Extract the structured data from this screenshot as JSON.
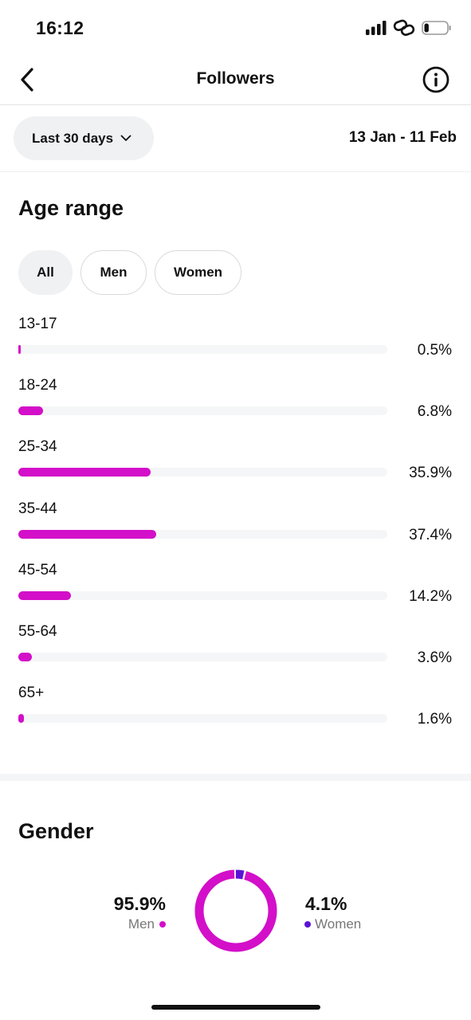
{
  "status_bar": {
    "time": "16:12",
    "battery_level": 0.2
  },
  "header": {
    "title": "Followers"
  },
  "filters": {
    "range_label": "Last 30 days",
    "date_range": "13 Jan - 11 Feb"
  },
  "age_section": {
    "title": "Age range",
    "tabs": [
      {
        "label": "All",
        "selected": true
      },
      {
        "label": "Men",
        "selected": false
      },
      {
        "label": "Women",
        "selected": false
      }
    ],
    "rows": [
      {
        "label": "13-17",
        "percent_text": "0.5%",
        "value": 0.5
      },
      {
        "label": "18-24",
        "percent_text": "6.8%",
        "value": 6.8
      },
      {
        "label": "25-34",
        "percent_text": "35.9%",
        "value": 35.9
      },
      {
        "label": "35-44",
        "percent_text": "37.4%",
        "value": 37.4
      },
      {
        "label": "45-54",
        "percent_text": "14.2%",
        "value": 14.2
      },
      {
        "label": "55-64",
        "percent_text": "3.6%",
        "value": 3.6
      },
      {
        "label": "65+",
        "percent_text": "1.6%",
        "value": 1.6
      }
    ]
  },
  "gender_section": {
    "title": "Gender",
    "men": {
      "value_text": "95.9%",
      "label": "Men",
      "value": 95.9
    },
    "women": {
      "value_text": "4.1%",
      "label": "Women",
      "value": 4.1
    }
  },
  "colors": {
    "men": "#d30fc9",
    "women": "#5a13d6",
    "track": "#f5f6f7"
  }
}
